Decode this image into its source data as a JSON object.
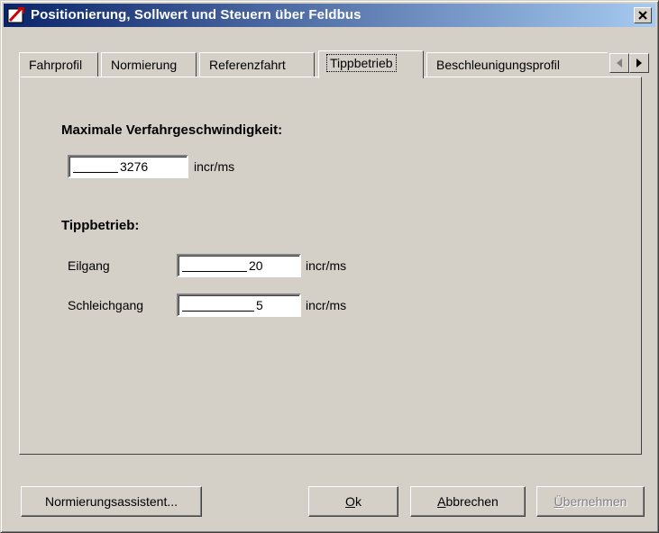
{
  "window": {
    "title": "Positionierung, Sollwert und Steuern über Feldbus",
    "close_symbol": "✕"
  },
  "tabs": [
    {
      "label": "Fahrprofil",
      "active": false
    },
    {
      "label": "Normierung",
      "active": false
    },
    {
      "label": "Referenzfahrt",
      "active": false
    },
    {
      "label": "Tippbetrieb",
      "active": true
    },
    {
      "label": "Beschleunigungsprofil",
      "active": false
    }
  ],
  "tab_scroll": {
    "left_icon": "triangle-left-icon",
    "right_icon": "triangle-right-icon"
  },
  "max_speed": {
    "heading": "Maximale Verfahrgeschwindigkeit:",
    "value": "3276",
    "unit": "incr/ms"
  },
  "jog": {
    "heading": "Tippbetrieb:",
    "fast": {
      "label": "Eilgang",
      "value": "20",
      "unit": "incr/ms"
    },
    "slow": {
      "label": "Schleichgang",
      "value": "5",
      "unit": "incr/ms"
    }
  },
  "buttons": {
    "wizard": "Normierungsassistent...",
    "ok_mnemonic": "O",
    "ok_rest": "k",
    "cancel_mnemonic": "A",
    "cancel_rest": "bbrechen",
    "apply_mnemonic": "Ü",
    "apply_rest": "bernehmen"
  }
}
